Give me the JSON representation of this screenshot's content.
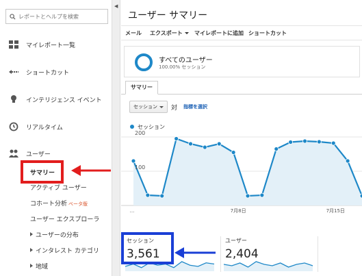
{
  "sidebar": {
    "search_placeholder": "レポートとヘルプを検索",
    "items": [
      {
        "label": "マイレポート一覧",
        "icon": "grid-icon"
      },
      {
        "label": "ショートカット",
        "icon": "shortcut-arrow-icon"
      },
      {
        "label": "インテリジェンス イベント",
        "icon": "lightbulb-icon"
      },
      {
        "label": "リアルタイム",
        "icon": "clock-icon"
      },
      {
        "label": "ユーザー",
        "icon": "users-icon"
      }
    ],
    "sub_items": [
      {
        "label": "サマリー",
        "selected": true
      },
      {
        "label": "アクティブ ユーザー"
      },
      {
        "label": "コホート分析",
        "badge": "ベータ版"
      },
      {
        "label": "ユーザー エクスプローラ"
      },
      {
        "label": "ユーザーの分布",
        "expandable": true
      },
      {
        "label": "インタレスト カテゴリ",
        "expandable": true
      },
      {
        "label": "地域",
        "expandable": true
      }
    ]
  },
  "main": {
    "title": "ユーザー サマリー",
    "toolbar": [
      "メール",
      "エクスポート",
      "マイレポートに追加",
      "ショートカット"
    ],
    "segment": {
      "name": "すべてのユーザー",
      "percent": "100.00% セッション"
    },
    "tab": "サマリー",
    "metric_select": "セッション",
    "vs": "対",
    "pick_metric": "指標を選択",
    "legend": "セッション"
  },
  "chart_data": {
    "type": "line",
    "series": [
      {
        "name": "セッション",
        "values": [
          130,
          30,
          28,
          195,
          180,
          170,
          180,
          155,
          28,
          30,
          165,
          185,
          188,
          186,
          182,
          130,
          28
        ]
      }
    ],
    "ylim": [
      0,
      220
    ],
    "y_ticks": [
      "200",
      "100"
    ],
    "x_labels": [
      "...",
      "7月8日",
      "7月15日"
    ],
    "color": "#1e88c8",
    "fill": "#e3f0f8"
  },
  "cards": [
    {
      "label": "セッション",
      "value": "3,561",
      "spark": [
        4,
        6,
        3,
        7,
        5,
        6,
        3,
        8,
        5,
        4,
        7,
        6
      ]
    },
    {
      "label": "ユーザー",
      "value": "2,404",
      "spark": [
        5,
        4,
        6,
        3,
        7,
        5,
        4,
        6,
        3,
        5,
        6,
        4
      ]
    }
  ],
  "annotations": {
    "red": "#e21d1d",
    "blue": "#1a3fd6"
  }
}
